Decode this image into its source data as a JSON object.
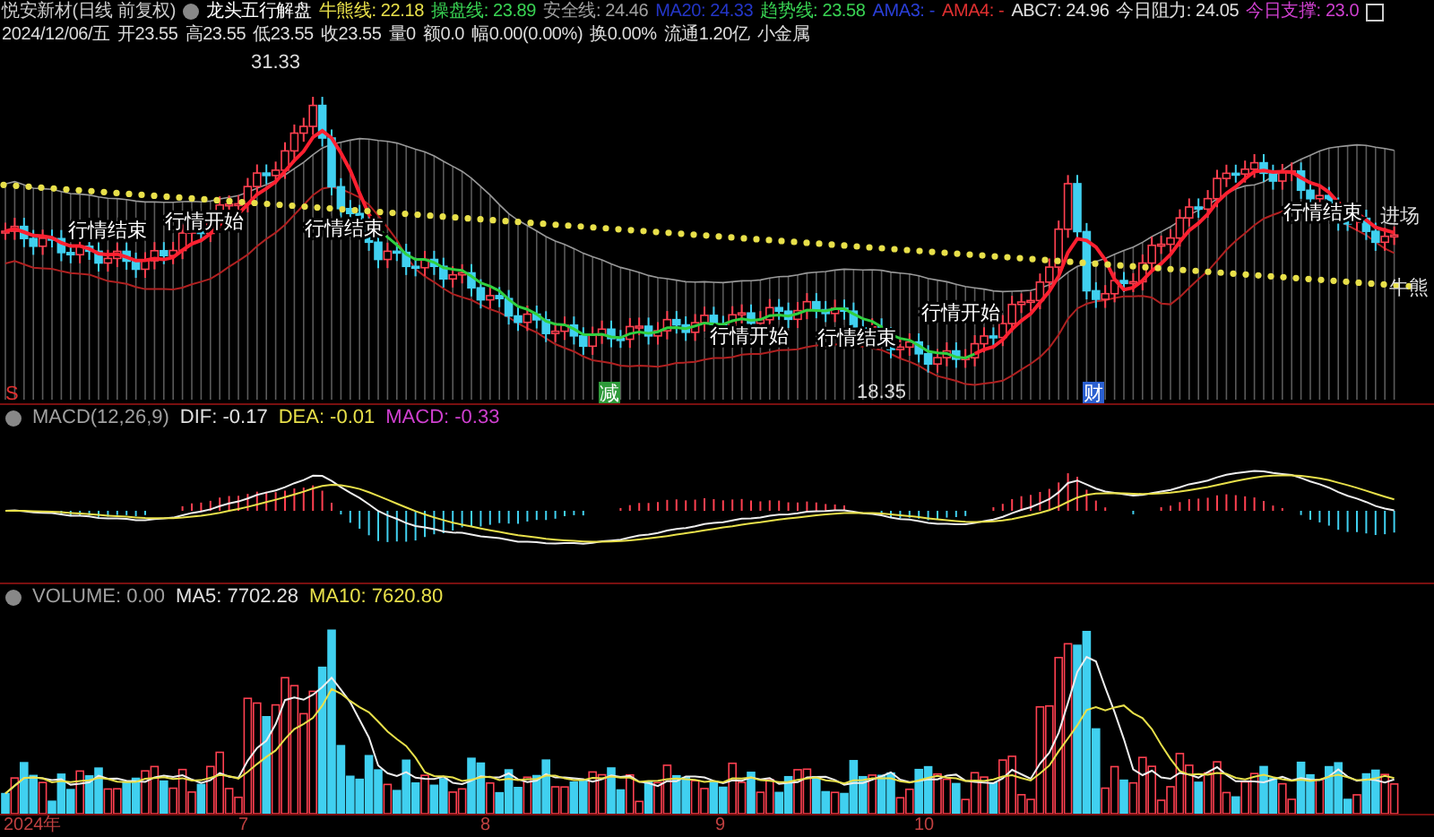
{
  "header": {
    "title": "悦安新材(日线 前复权)",
    "formula": "龙头五行解盘",
    "indicators": [
      {
        "label": "牛熊线: 22.18",
        "color": "#e8e04a"
      },
      {
        "label": "操盘线: 23.89",
        "color": "#39d353"
      },
      {
        "label": "安全线: 24.46",
        "color": "#a0a0a0"
      },
      {
        "label": "MA20: 24.33",
        "color": "#2436c8"
      },
      {
        "label": "趋势线: 23.58",
        "color": "#39d353"
      },
      {
        "label": "AMA3: -",
        "color": "#2a3fd8"
      },
      {
        "label": "AMA4: -",
        "color": "#e03030"
      },
      {
        "label": "ABC7: 24.96",
        "color": "#e0e0e0"
      },
      {
        "label": "今日阻力: 24.05",
        "color": "#e0e0e0"
      },
      {
        "label": "今日支撑: 23.0",
        "color": "#d040d0"
      }
    ],
    "quote": [
      "2024/12/06/五",
      "开23.55",
      "高23.55",
      "低23.55",
      "收23.55",
      "量0",
      "额0.0",
      "幅0.00(0.00%)",
      "换0.00%",
      "流通1.20亿",
      "小金属"
    ]
  },
  "price_chart": {
    "labels": [
      {
        "kind": "price",
        "text": "31.33"
      },
      {
        "kind": "signal",
        "text": "行情结束"
      },
      {
        "kind": "signal",
        "text": "行情开始"
      },
      {
        "kind": "signal",
        "text": "行情结束"
      },
      {
        "kind": "signal",
        "text": "行情开始"
      },
      {
        "kind": "signal",
        "text": "行情结束"
      },
      {
        "kind": "signal",
        "text": "行情开始"
      },
      {
        "kind": "signal",
        "text": "行情结束"
      },
      {
        "kind": "line",
        "text": "进场"
      },
      {
        "kind": "line",
        "text": "牛熊"
      },
      {
        "kind": "marker",
        "text": "S",
        "color": "#e03030"
      },
      {
        "kind": "badge",
        "text": "减",
        "color": "#2e9a3a"
      },
      {
        "kind": "price",
        "text": "18.35"
      },
      {
        "kind": "badge",
        "text": "财",
        "color": "#2a5fd0"
      }
    ]
  },
  "macd": {
    "items": [
      {
        "label": "MACD(12,26,9)",
        "color": "#a0a0a0"
      },
      {
        "label": "DIF: -0.17",
        "color": "#e0e0e0"
      },
      {
        "label": "DEA: -0.01",
        "color": "#e8e04a"
      },
      {
        "label": "MACD: -0.33",
        "color": "#d040d0"
      }
    ]
  },
  "volume": {
    "items": [
      {
        "label": "VOLUME: 0.00",
        "color": "#a0a0a0"
      },
      {
        "label": "MA5: 7702.28",
        "color": "#e0e0e0"
      },
      {
        "label": "MA10: 7620.80",
        "color": "#e8e04a"
      }
    ]
  },
  "time_axis": [
    "2024年",
    "7",
    "8",
    "9",
    "10"
  ]
}
